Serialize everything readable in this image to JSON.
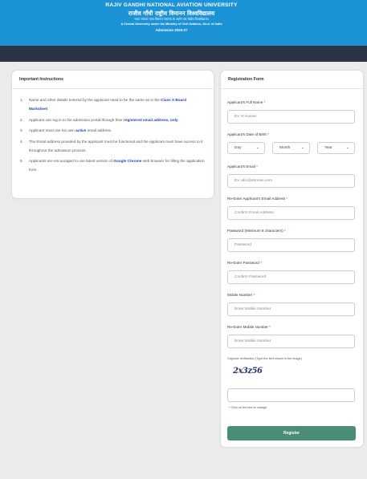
{
  "header": {
    "title": "RAJIV GANDHI NATIONAL AVIATION UNIVERSITY",
    "hindi_title": "राजीव गाँधी राष्ट्रीय विमानन विश्वविद्यालय",
    "hindi_sub": "भारत सरकार नागर विमानन मंत्रालय के अधीन एक केंद्रीय विश्वविद्यालय",
    "subtitle": "A Central University under the Ministry of Civil Aviation, Govt. of India",
    "admission": "Admission 2026-27"
  },
  "instructions": {
    "heading": "Important Instructions",
    "items": [
      {
        "num": "1.",
        "pre": "Name and other details entered by the applicant need to be the same as in the ",
        "hl": "Class X Board Marksheet",
        "post": ""
      },
      {
        "num": "2.",
        "pre": "Applicant can log in to the admission portal through their ",
        "hl": "registered email address, only",
        "post": "."
      },
      {
        "num": "3.",
        "pre": "Applicant must use his own ",
        "hl": "active",
        "post": " email address."
      },
      {
        "num": "4.",
        "pre": "The Email address provided by the applicant must be functional and the applicant must have access to it throughout the admission process.",
        "hl": "",
        "post": ""
      },
      {
        "num": "5.",
        "pre": "Applicants are encouraged to use latest version of ",
        "hl": "Google Chrome",
        "post": " web browser for filling the application form."
      }
    ]
  },
  "form": {
    "heading": "Registration Form",
    "full_name_label": "Applicant's Full Name",
    "full_name_placeholder": "Ex: R Kumar",
    "dob_label": "Applicant's Date of Birth",
    "day": "Day",
    "month": "Month",
    "year": "Year",
    "email_label": "Applicant's Email",
    "email_placeholder": "Ex: abc@domain.com",
    "reemail_label": "Re-Enter Applicant's Email Address",
    "reemail_placeholder": "Confirm Email Address",
    "password_label": "Password (Minimum 8 characters)",
    "password_placeholder": "Password",
    "repassword_label": "Re-Enter Password",
    "repassword_placeholder": "Confirm Password",
    "mobile_label": "Mobile Number",
    "mobile_placeholder": "Enter Mobile Number",
    "remobile_label": "Re-Enter Mobile Number",
    "remobile_placeholder": "Enter Mobile Number",
    "captcha_label": "Captcha Verification (Type the text shown in the image)",
    "captcha_text": "2x3z56",
    "captcha_hint": "* Click on the text to change",
    "required_mark": "*",
    "submit": "Register"
  },
  "colors": {
    "header_bg": "#1c93d6",
    "navbar_bg": "#2b3442",
    "button_bg": "#4a8e78",
    "highlight": "#2a40b8",
    "required": "#d42020"
  },
  "icons": {
    "select_chevron": "⌄"
  }
}
